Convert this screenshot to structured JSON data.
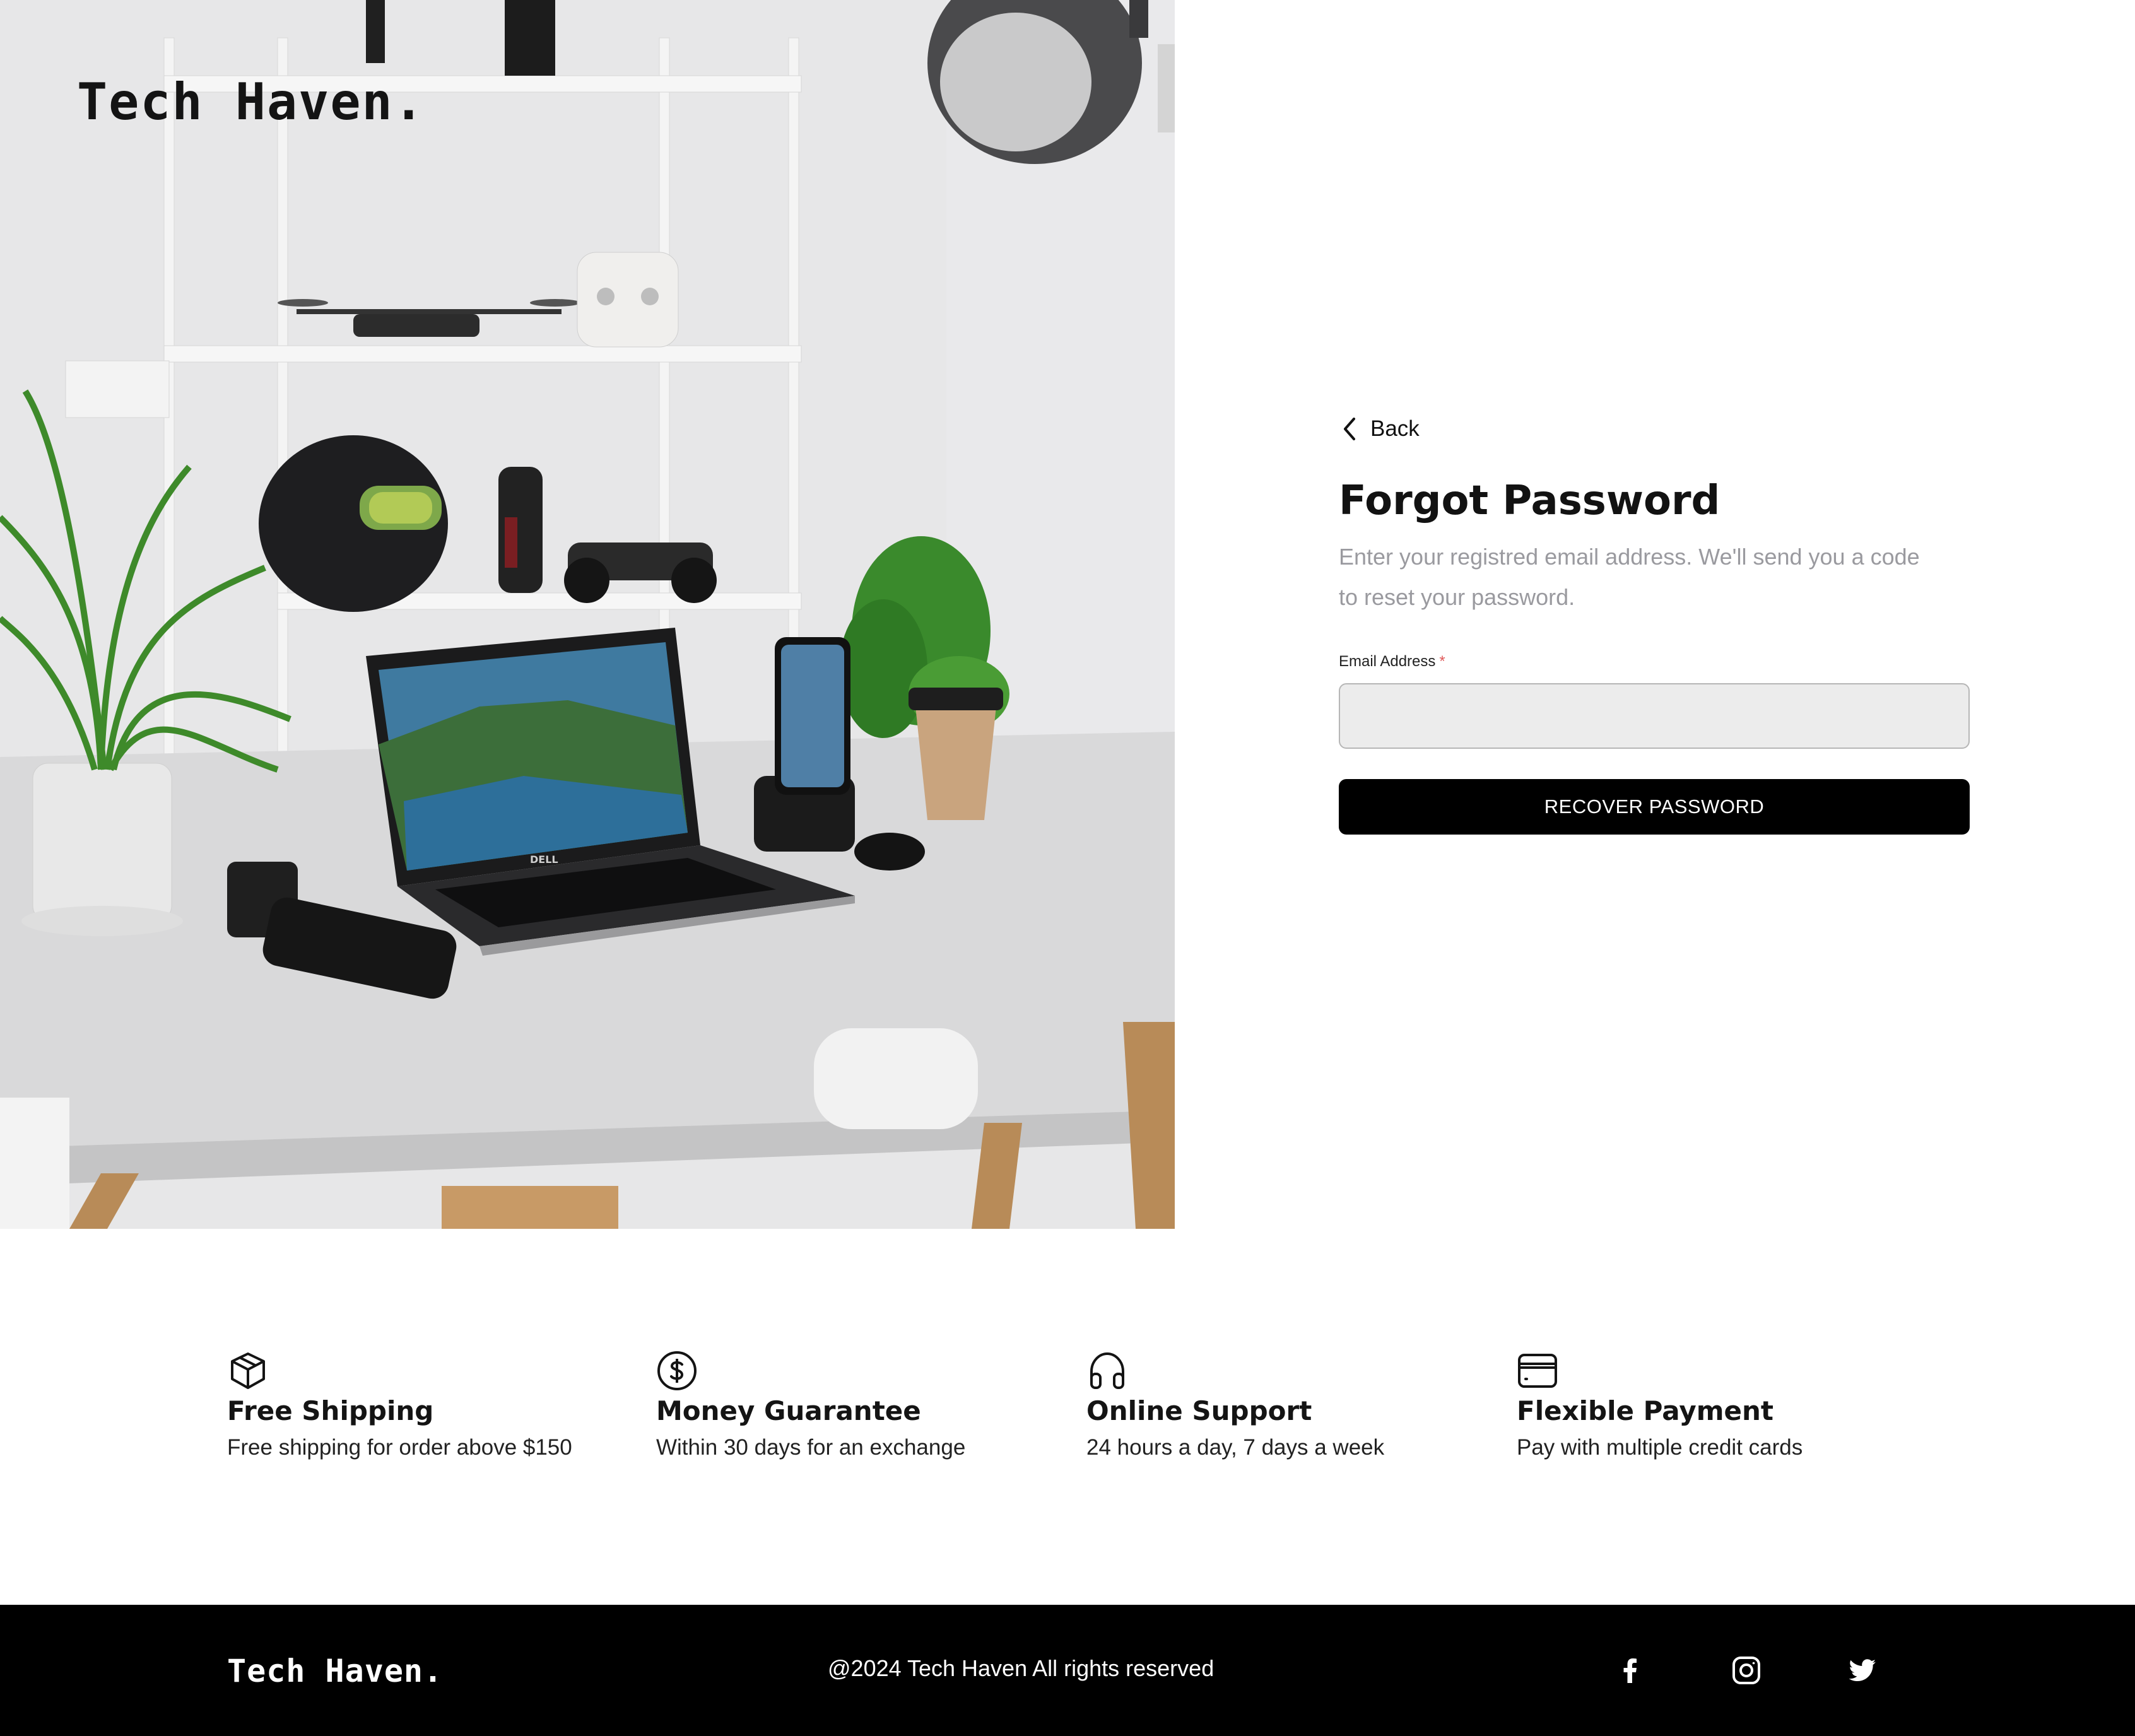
{
  "brand": "Tech Haven.",
  "hero": {
    "laptop_badge": "DELL"
  },
  "back": {
    "label": "Back",
    "icon": "chevron-left-icon"
  },
  "form": {
    "title": "Forgot Password",
    "description": "Enter your registred email address. We'll send you a code to reset your password.",
    "email_label": "Email Address",
    "required_marker": "*",
    "email_value": "",
    "email_placeholder": "",
    "submit_label": "RECOVER PASSWORD"
  },
  "features": [
    {
      "icon": "package-icon",
      "title": "Free Shipping",
      "description": "Free shipping for order above $150"
    },
    {
      "icon": "dollar-coin-icon",
      "title": "Money Guarantee",
      "description": "Within 30 days for an exchange"
    },
    {
      "icon": "headphones-icon",
      "title": "Online Support",
      "description": "24 hours a day, 7 days a week"
    },
    {
      "icon": "credit-card-icon",
      "title": "Flexible Payment",
      "description": "Pay with multiple credit cards"
    }
  ],
  "footer": {
    "brand": "Tech Haven.",
    "copyright": "@2024 Tech Haven All rights reserved",
    "social": [
      "facebook-icon",
      "instagram-icon",
      "twitter-icon"
    ]
  },
  "colors": {
    "primary_button": "#000000",
    "required_asterisk": "#e05a5a",
    "description_text": "#9a9a9f",
    "input_background": "#ececec",
    "footer_background": "#000000"
  }
}
